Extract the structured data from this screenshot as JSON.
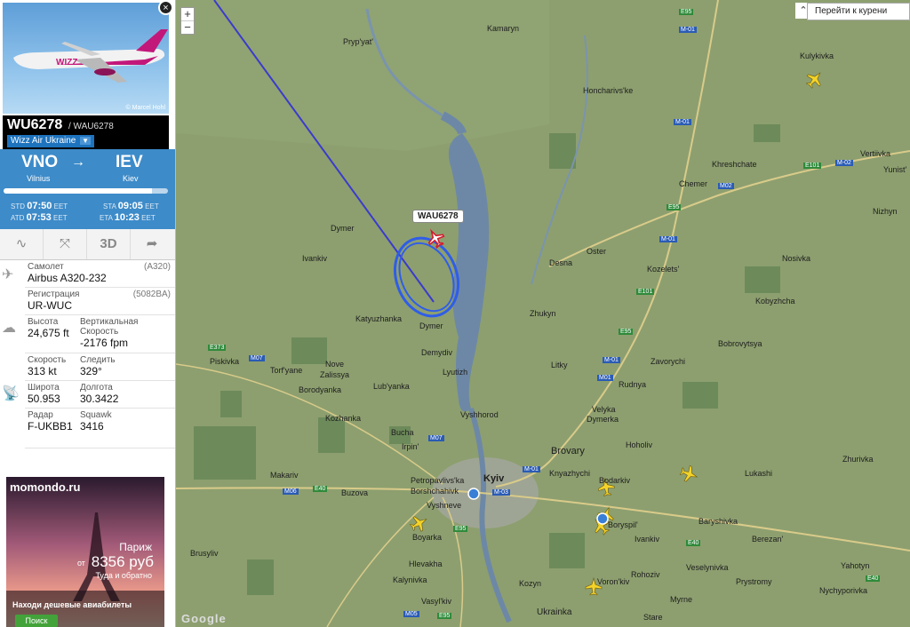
{
  "sidebar": {
    "photo_credit": "© Marcel Hohl",
    "close_label": "×",
    "flight_number": "WU6278",
    "flight_code": "/ WAU6278",
    "airline": "Wizz Air Ukraine",
    "airline_dropdown": "▼",
    "origin": {
      "code": "VNO",
      "city": "Vilnius"
    },
    "destination": {
      "code": "IEV",
      "city": "Kiev"
    },
    "route_arrow": "→",
    "progress": 0.9,
    "times": {
      "std_label": "STD",
      "std_value": "07:50",
      "std_tz": "EET",
      "atd_label": "ATD",
      "atd_value": "07:53",
      "atd_tz": "EET",
      "sta_label": "STA",
      "sta_value": "09:05",
      "sta_tz": "EET",
      "eta_label": "ETA",
      "eta_value": "10:23",
      "eta_tz": "EET"
    },
    "toolbar": {
      "route": "∿",
      "fullscreen": "⤧",
      "view3d": "3D",
      "share": "➦"
    },
    "details": {
      "aircraft_label": "Самолет",
      "aircraft_code": "(A320)",
      "aircraft_value": "Airbus A320-232",
      "reg_label": "Регистрация",
      "reg_code": "(5082BA)",
      "reg_value": "UR-WUC",
      "alt_label": "Высота",
      "alt_value": "24,675 ft",
      "vs_label": "Вертикальная Скорость",
      "vs_value": "-2176 fpm",
      "speed_label": "Скорость",
      "speed_value": "313 kt",
      "track_label": "Следить",
      "track_value": "329°",
      "lat_label": "Широта",
      "lat_value": "50.953",
      "lon_label": "Долгота",
      "lon_value": "30.3422",
      "radar_label": "Радар",
      "radar_value": "F-UKBB1",
      "squawk_label": "Squawk",
      "squawk_value": "3416"
    },
    "ad": {
      "brand": "momondo.ru",
      "city": "Париж",
      "from": "от",
      "price": "8356 руб",
      "round_trip": "Туда и обратно",
      "cta": "Находи дешевые авиабилеты",
      "button": "Поиск"
    }
  },
  "map": {
    "zoom_in": "+",
    "zoom_out": "−",
    "goto_label": "Перейти к курени",
    "goto_icon": "⌃",
    "flight_label": "WAU6278",
    "google": "Google",
    "towns": {
      "kamaryn": "Kamaryn",
      "prypyat": "Pryp'yat'",
      "kulykivka": "Kulykivka",
      "honcharivs": "Honcharivs'ke",
      "vertiivka": "Vertiivka",
      "kreshchate": "Khreshchate",
      "yunist": "Yunist'",
      "chemer": "Chemer",
      "nizhyn": "Nizhyn",
      "dymer1": "Dymer",
      "ivankiv": "Ivankiv",
      "oster": "Oster",
      "desna": "Desna",
      "kozelets": "Kozelets'",
      "nosivka": "Nosivka",
      "kobyzhcha": "Kobyzhcha",
      "katyuzhanka": "Katyuzhanka",
      "dymer2": "Dymer",
      "zhukyn": "Zhukyn",
      "bobrovytsya": "Bobrovytsya",
      "piskivka": "Piskivka",
      "torfyane": "Torf'yane",
      "nove": "Nove",
      "zalissya": "Zalissya",
      "demydiv": "Demydiv",
      "litky": "Litky",
      "zavorychi": "Zavorychi",
      "borodyanka": "Borodyanka",
      "lubyanka": "Lub'yanka",
      "lyutizh": "Lyutizh",
      "rudnya": "Rudnya",
      "kozhanka": "Kozhanka",
      "vyshhorod": "Vyshhorod",
      "velyka": "Velyka",
      "dymerka": "Dymerka",
      "bucha": "Bucha",
      "irpin": "Irpin'",
      "hoholiv": "Hoholiv",
      "brovary": "Brovary",
      "zhurivka": "Zhurivka",
      "makariv": "Makariv",
      "petropavlivska": "Petropavlivs'ka",
      "borshchahivka": "Borshchahivk",
      "kyiv": "Kyiv",
      "knyazhychi": "Knyazhychi",
      "bodarkiv": "Bodarkiv",
      "lukashi": "Lukashi",
      "buzova": "Buzova",
      "vyshneve": "Vyshneve",
      "boryspil": "Boryspil'",
      "baryshivka": "Baryshivka",
      "berezan": "Berezan'",
      "boyarka": "Boyarka",
      "ivankiv2": "Ivankiv",
      "brusyliv": "Brusyliv",
      "hlevakha": "Hlevakha",
      "veselynivka": "Veselynivka",
      "yahotyn": "Yahotyn",
      "kalynivka": "Kalynivka",
      "rohoziv": "Rohoziv",
      "prystromy": "Prystromy",
      "kozyn": "Kozyn",
      "vasylkiv": "Vasyl'kiv",
      "myrne": "Myrne",
      "nychyporivka": "Nychyporivka",
      "ukrainka": "Ukrainka",
      "stare": "Stare",
      "voronkiv": "Voron'kiv"
    },
    "roads": {
      "e95a": "E95",
      "m01a": "M-01",
      "m01b": "M-01",
      "e101a": "E101",
      "m02a": "M-02",
      "m02b": "M02",
      "e95b": "E95",
      "m01c": "M-01",
      "e101b": "E101",
      "e95c": "E95",
      "e373": "E373",
      "m07a": "M07",
      "m01d": "M-01",
      "m01e": "M01",
      "m07b": "M07",
      "m01f": "M-01",
      "m06": "M06",
      "e40a": "E40",
      "m03": "M-03",
      "e95d": "E95",
      "e40b": "E40",
      "e40c": "E40",
      "m05": "M05",
      "e95e": "E95"
    }
  }
}
